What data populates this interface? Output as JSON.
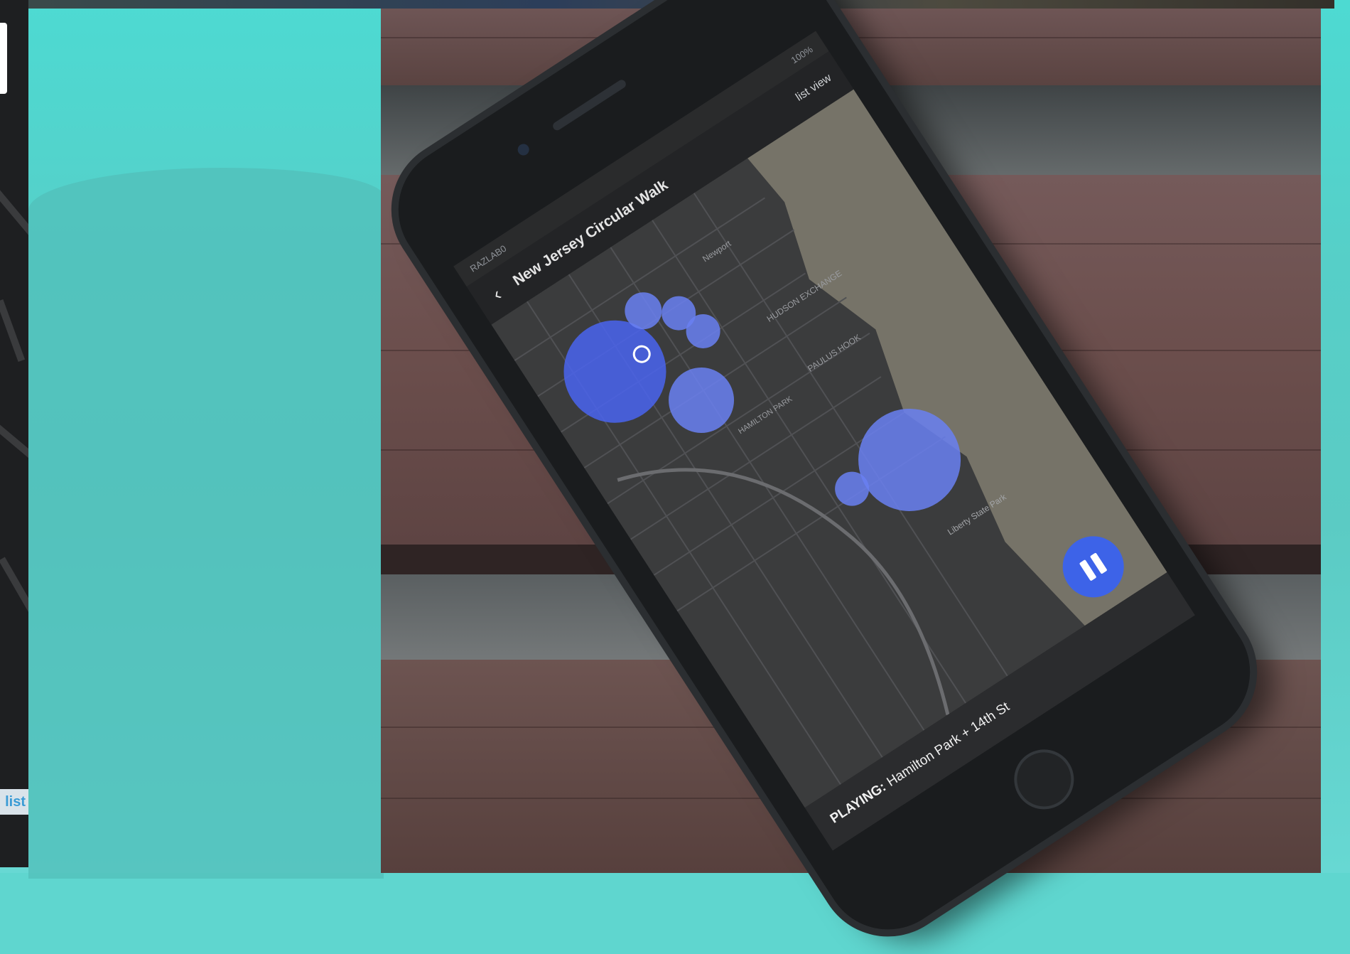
{
  "left_panel": {
    "list_button_label": "list"
  },
  "phone": {
    "status": {
      "carrier": "RAZLAB0",
      "battery": "100%"
    },
    "appbar": {
      "back_label": "‹",
      "title": "New Jersey Circular Walk",
      "list_view_label": "list view"
    },
    "map": {
      "labels": [
        "Newport",
        "HUDSON EXCHANGE",
        "PAULUS HOOK",
        "Liberty State Park",
        "HAMILTON PARK"
      ]
    },
    "player": {
      "prefix": "PLAYING:",
      "track": "Hamilton Park + 14th St"
    },
    "pause_button_icon": "pause-icon"
  },
  "colors": {
    "background_teal": "#5fd6cf",
    "accent_blue": "#3d63e8",
    "circle_blue": "#5a74f0"
  }
}
